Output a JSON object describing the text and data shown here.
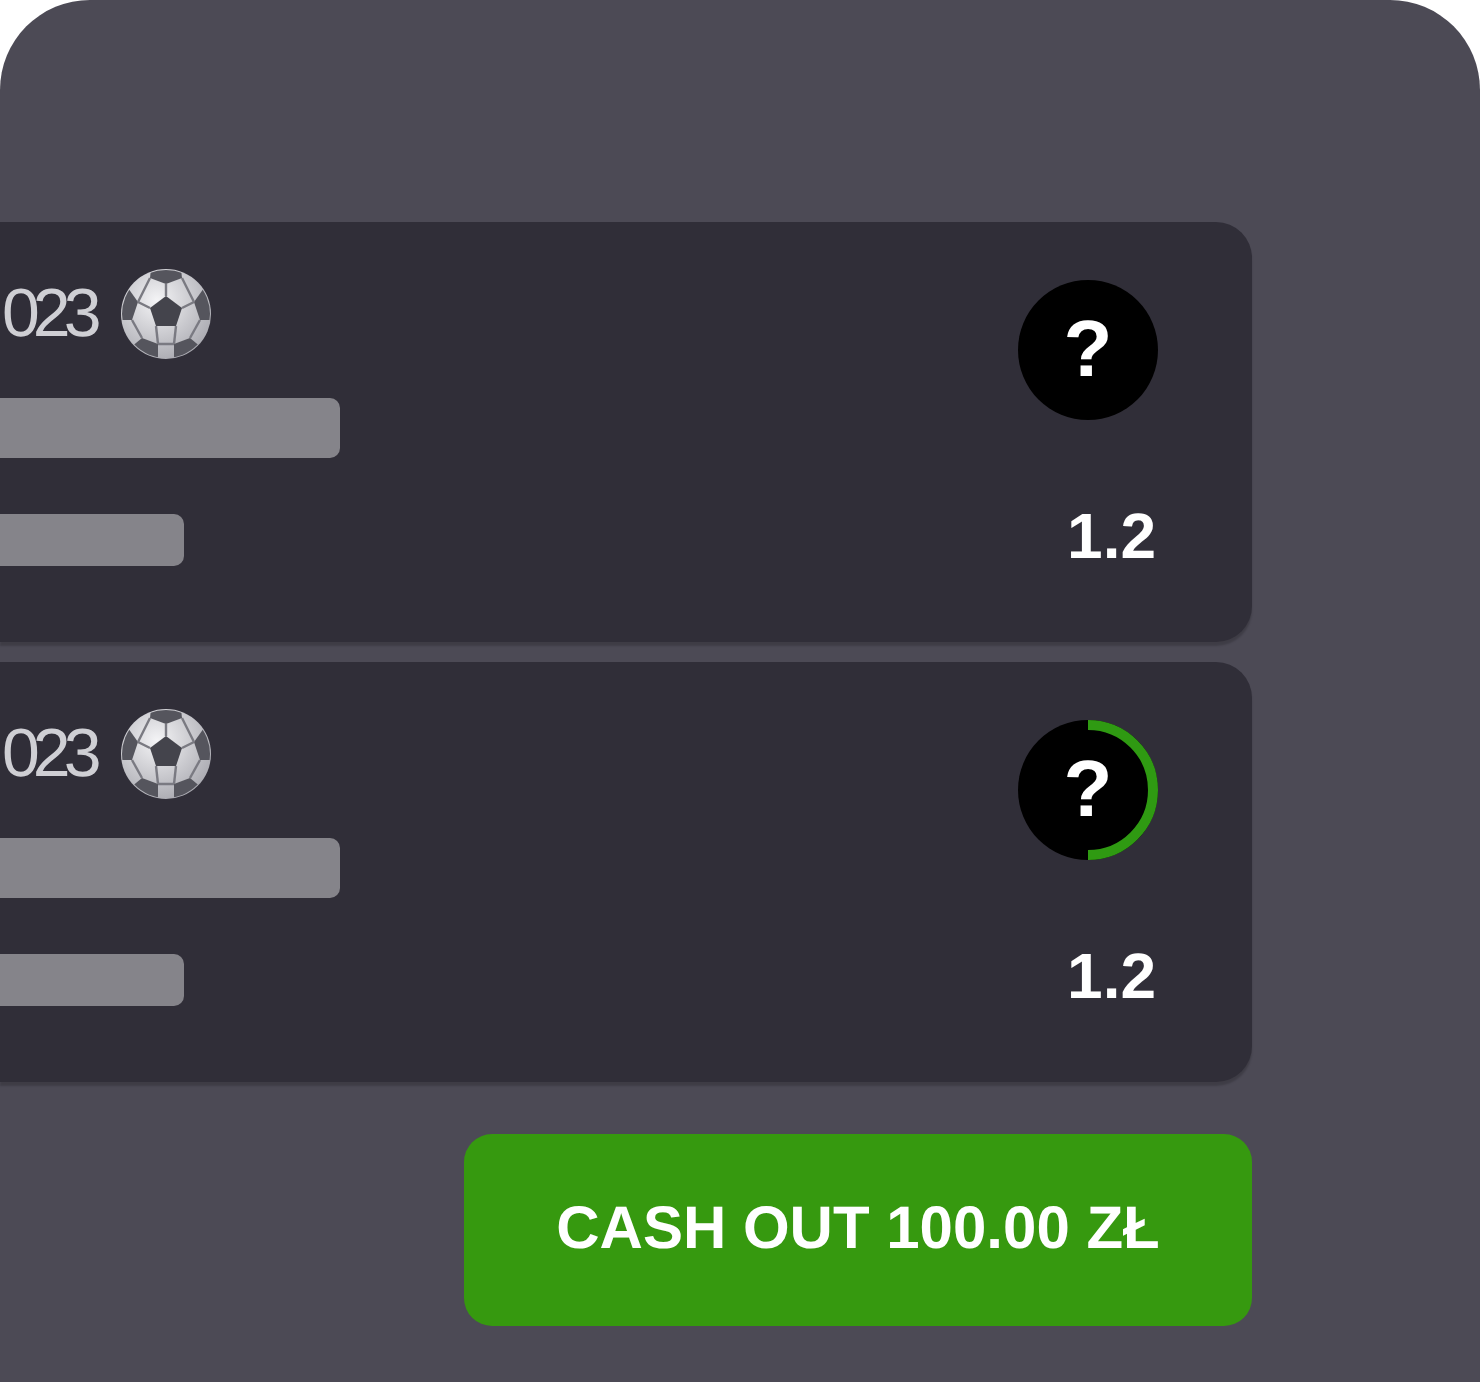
{
  "cards": [
    {
      "title": "023",
      "badge": "?",
      "odds": "1.2"
    },
    {
      "title": "023",
      "badge": "?",
      "level": 0.5,
      "odds": "1.2"
    }
  ],
  "cash_out_button": {
    "label": "CASH OUT 100.00 ZŁ"
  }
}
